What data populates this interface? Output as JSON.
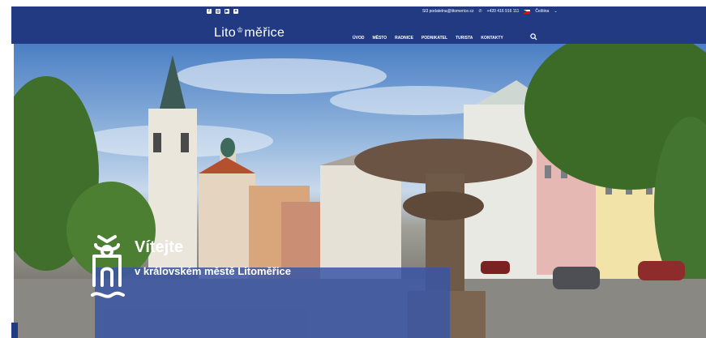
{
  "topbar": {
    "social_icons": [
      "facebook-icon",
      "instagram-icon",
      "youtube-icon",
      "twitter-icon"
    ],
    "email": "Sl3 podatelna@litomerice.cz",
    "phone": "+420 416 916 111",
    "language": "Čeština"
  },
  "logo": {
    "text_before": "Lito",
    "mark": "♔",
    "text_after": "měřice"
  },
  "nav": {
    "items": [
      {
        "label": "ÚVOD"
      },
      {
        "label": "MĚSTO"
      },
      {
        "label": "RADNICE"
      },
      {
        "label": "PODNIKATEL"
      },
      {
        "label": "TURISTA"
      },
      {
        "label": "KONTAKTY"
      }
    ]
  },
  "hero": {
    "title": "Vítejte",
    "subtitle": "v královském městě Litoměřice"
  },
  "colors": {
    "header_bg": "#213a82",
    "callout_bg": "#3956a4",
    "accent": "#d7141a"
  }
}
